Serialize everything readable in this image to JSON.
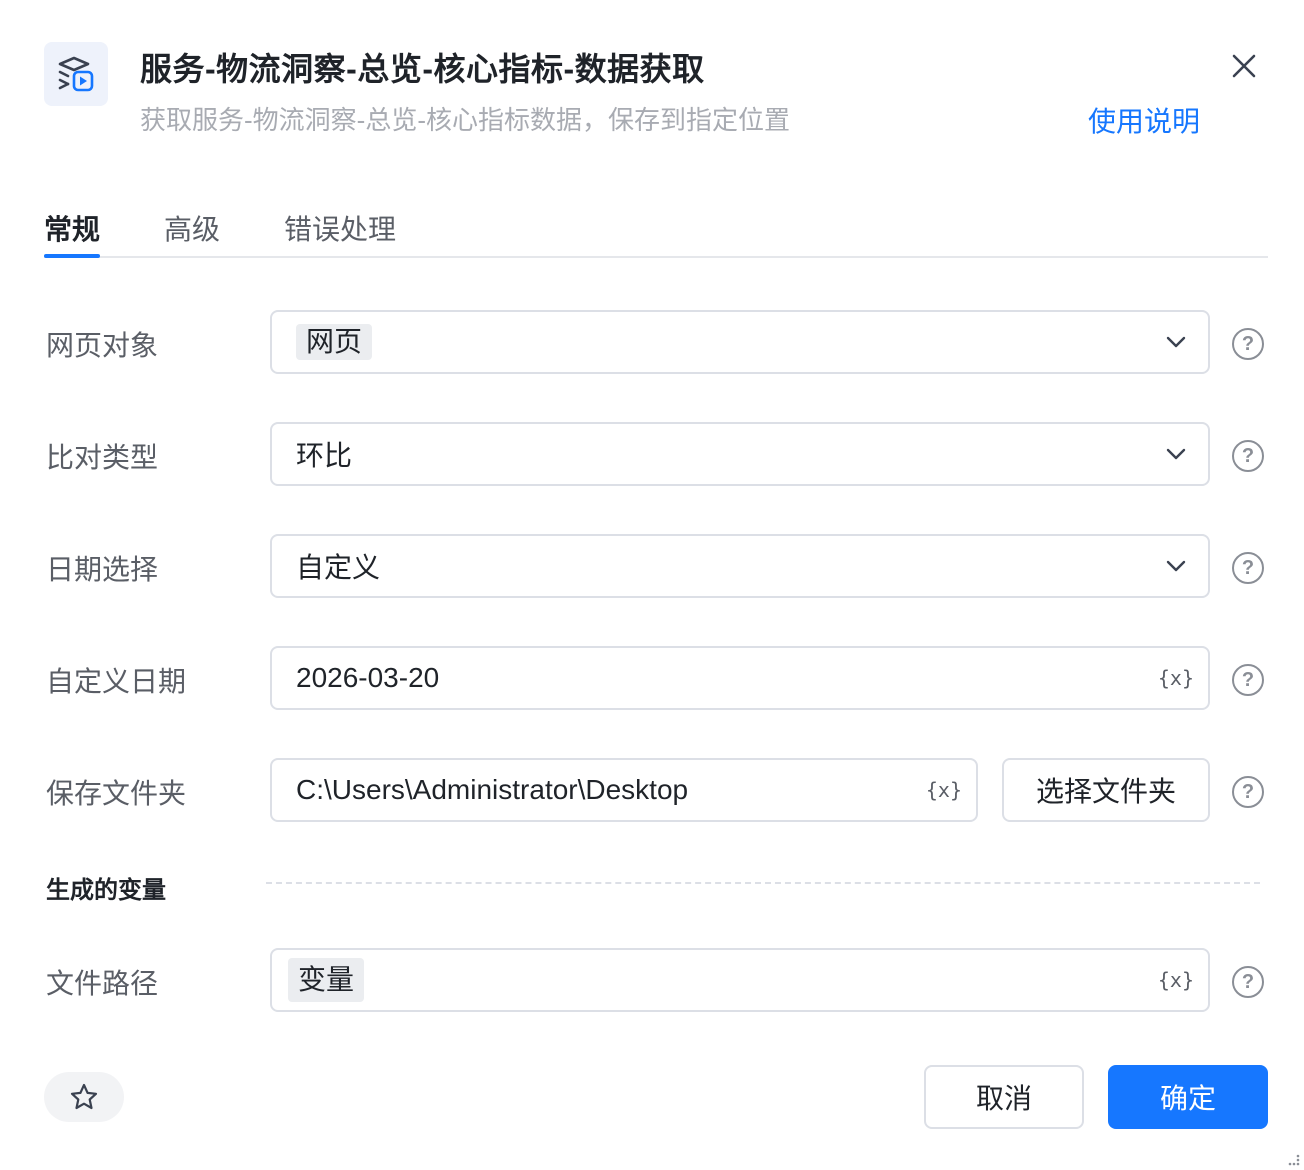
{
  "header": {
    "title": "服务-物流洞察-总览-核心指标-数据获取",
    "subtitle": "获取服务-物流洞察-总览-核心指标数据，保存到指定位置",
    "help_link": "使用说明",
    "app_icon": "layers-play-icon",
    "close_icon": "close-icon"
  },
  "tabs": [
    {
      "label": "常规",
      "active": true
    },
    {
      "label": "高级",
      "active": false
    },
    {
      "label": "错误处理",
      "active": false
    }
  ],
  "form": {
    "web_object": {
      "label": "网页对象",
      "value": "网页"
    },
    "compare_type": {
      "label": "比对类型",
      "value": "环比"
    },
    "date_select": {
      "label": "日期选择",
      "value": "自定义"
    },
    "custom_date": {
      "label": "自定义日期",
      "value": "2026-03-20"
    },
    "save_folder": {
      "label": "保存文件夹",
      "value": "C:\\Users\\Administrator\\Desktop",
      "button": "选择文件夹"
    },
    "variable_icon": "{x}",
    "help_icon": "?"
  },
  "generated_vars": {
    "section_title": "生成的变量",
    "file_path": {
      "label": "文件路径",
      "value": "变量"
    }
  },
  "footer": {
    "favorite_icon": "star-icon",
    "cancel": "取消",
    "confirm": "确定"
  },
  "colors": {
    "accent": "#1677ff",
    "border": "#dcdfe6",
    "muted_text": "#a8abb2"
  }
}
